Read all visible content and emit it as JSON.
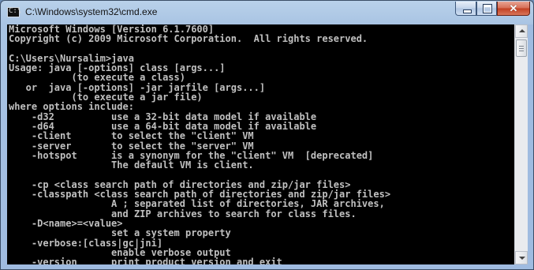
{
  "window": {
    "title": "C:\\Windows\\system32\\cmd.exe",
    "icon": "console-icon",
    "icon_glyph": "C:\\"
  },
  "controls": {
    "minimize": "minimize-icon",
    "maximize": "maximize-icon",
    "close_glyph": "✕"
  },
  "console": {
    "text": "Microsoft Windows [Version 6.1.7600]\nCopyright (c) 2009 Microsoft Corporation.  All rights reserved.\n\nC:\\Users\\Nursalim>java\nUsage: java [-options] class [args...]\n           (to execute a class)\n   or  java [-options] -jar jarfile [args...]\n           (to execute a jar file)\nwhere options include:\n    -d32          use a 32-bit data model if available\n    -d64          use a 64-bit data model if available\n    -client       to select the \"client\" VM\n    -server       to select the \"server\" VM\n    -hotspot      is a synonym for the \"client\" VM  [deprecated]\n                  The default VM is client.\n\n    -cp <class search path of directories and zip/jar files>\n    -classpath <class search path of directories and zip/jar files>\n                  A ; separated list of directories, JAR archives,\n                  and ZIP archives to search for class files.\n    -D<name>=<value>\n                  set a system property\n    -verbose:[class|gc|jni]\n                  enable verbose output\n    -version      print product version and exit",
    "text_color": "#c0c0c0",
    "background": "#000000"
  },
  "scrollbar": {
    "position": 0.0
  }
}
